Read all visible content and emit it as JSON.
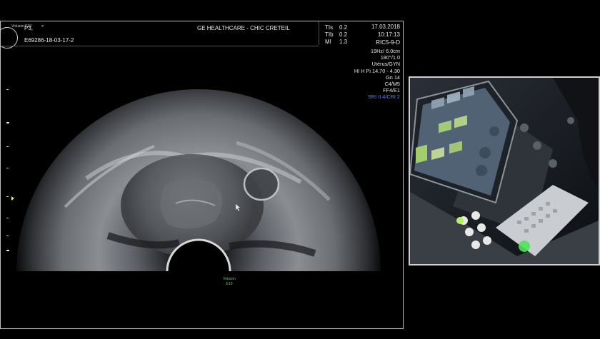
{
  "header": {
    "logo_text": "Voluson E10",
    "patient": "P3,",
    "patient_mark": "°",
    "exam_id": "E69286-18-03-17-2",
    "institution": "GE HEALTHCARE - CHIC CRETEIL",
    "indices": [
      {
        "label": "TIs",
        "value": "0.2"
      },
      {
        "label": "TIb",
        "value": "0.2"
      },
      {
        "label": "MI",
        "value": "1.3"
      }
    ],
    "date": "17.03.2018",
    "time": "10:17:13",
    "probe": "RIC5-9-D"
  },
  "imaging_params": [
    "19Hz/ 6.0cm",
    "180°/1.0",
    "Utérus/GYN",
    "HI H Pi 14.70 - 4.30",
    "Gn  14",
    "C4/M5",
    "FF4/E1"
  ],
  "imaging_params_highlight": "SRI II 4/CRI 2",
  "footer": {
    "line1": "Voluson",
    "line2": "E10"
  },
  "colors": {
    "frame_border": "#bdbdbd",
    "highlight_text": "#6f7dff",
    "footer_text": "#5fd06a",
    "background": "#000000"
  }
}
